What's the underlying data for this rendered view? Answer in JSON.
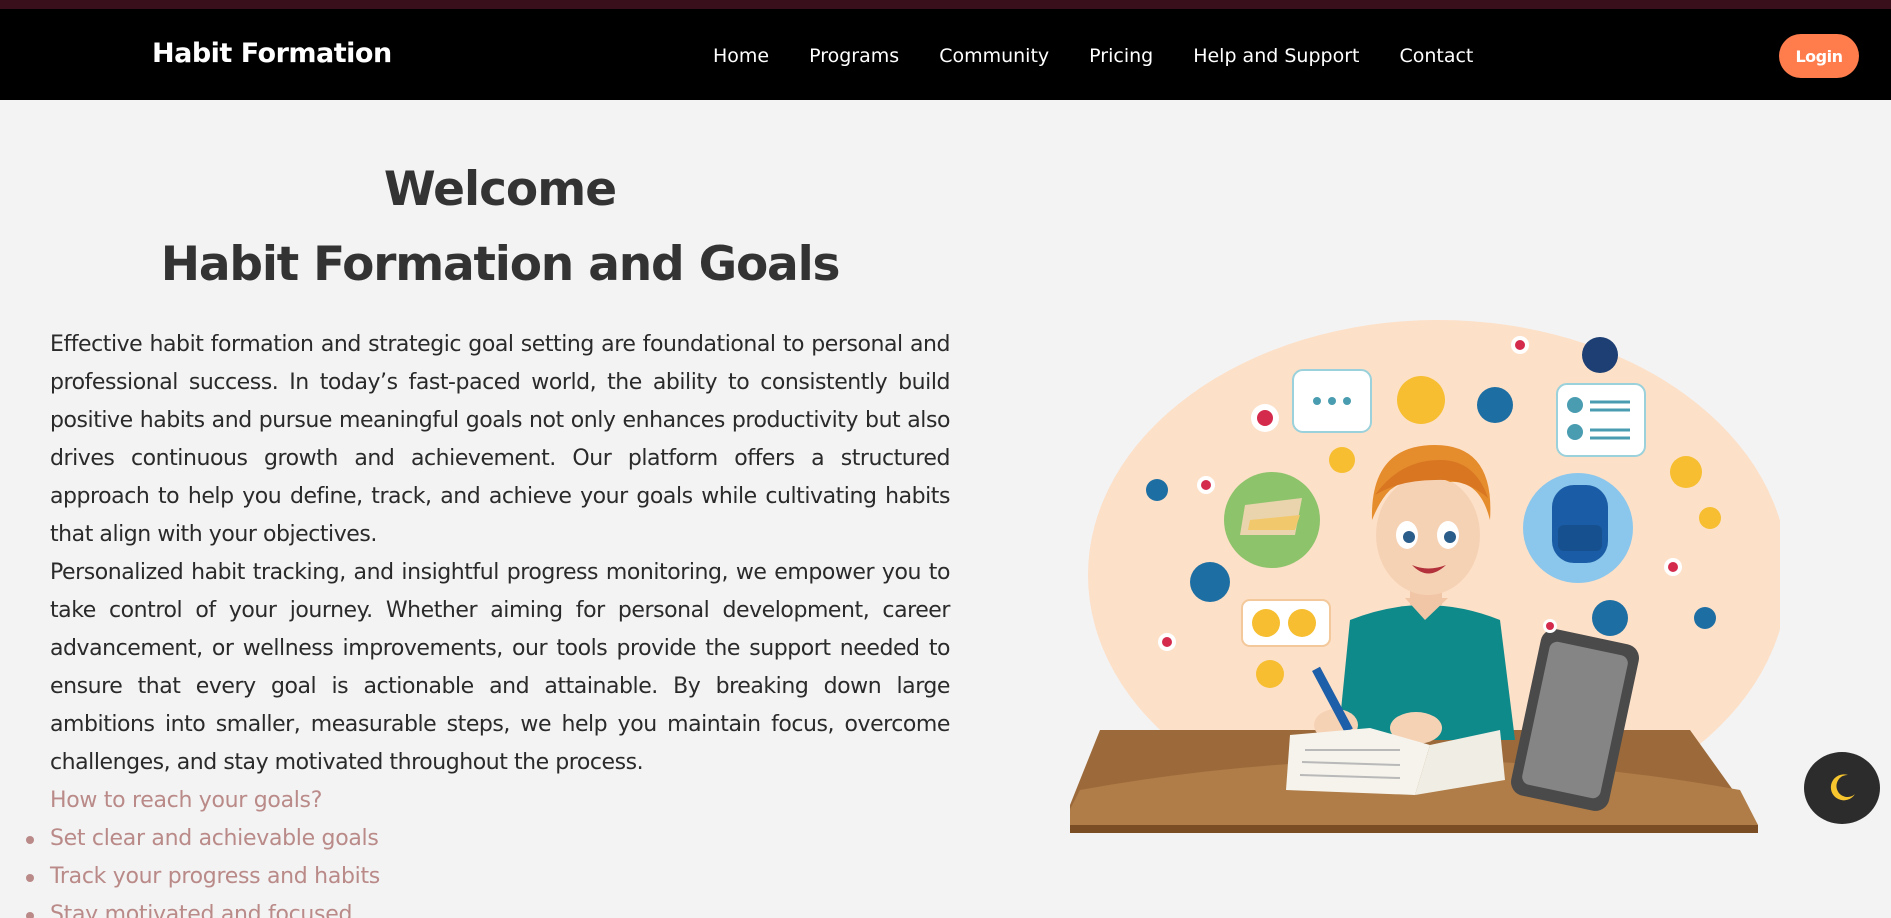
{
  "header": {
    "brand": "Habit Formation",
    "nav": [
      "Home",
      "Programs",
      "Community",
      "Pricing",
      "Help and Support",
      "Contact"
    ],
    "login_label": "Login"
  },
  "hero": {
    "heading": "Welcome",
    "subheading": "Habit Formation and Goals",
    "paragraphs": [
      "Effective habit formation and strategic goal setting are foundational to personal and professional success. In today’s fast-paced world, the ability to consistently build positive habits and pursue meaningful goals not only enhances productivity but also drives continuous growth and achievement. Our platform offers a structured approach to help you define, track, and achieve your goals while cultivating habits that align with your objectives.",
      "Personalized habit tracking, and insightful progress monitoring, we empower you to take control of your journey. Whether aiming for personal development, career advancement, or wellness improvements, our tools provide the support needed to ensure that every goal is actionable and attainable. By breaking down large ambitions into smaller, measurable steps, we help you maintain focus, overcome challenges, and stay motivated throughout the process."
    ],
    "goals_title": "How to reach your goals?",
    "goals": [
      "Set clear and achievable goals",
      "Track your progress and habits",
      "Stay motivated and focused"
    ]
  },
  "theme_toggle": {
    "icon": "moon-icon"
  },
  "colors": {
    "navbar": "#000000",
    "accent": "#ff7d4d",
    "goals_text": "#b98a88",
    "background": "#f3f3f3"
  }
}
